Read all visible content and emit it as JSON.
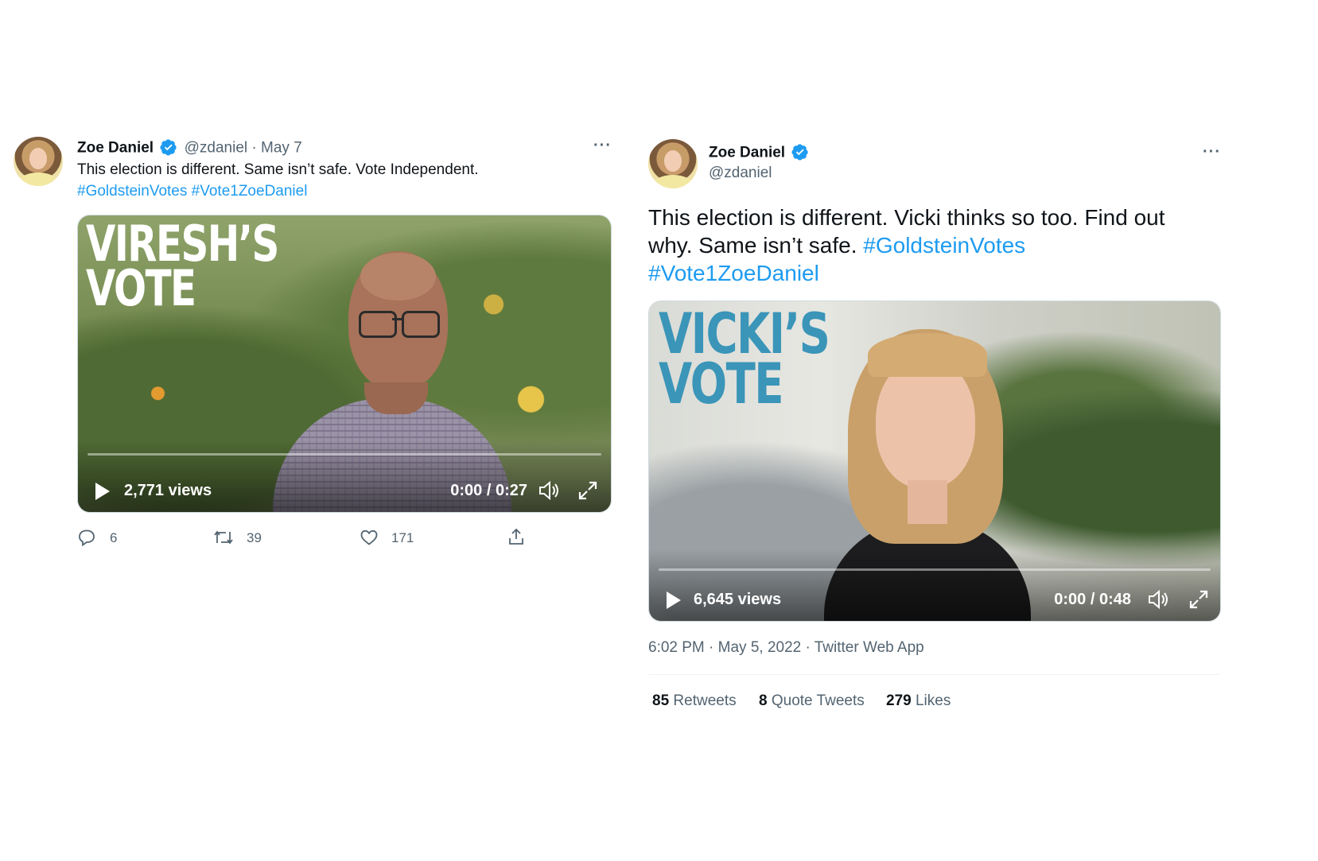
{
  "left_tweet": {
    "name": "Zoe Daniel",
    "handle": "@zdaniel",
    "separator": "·",
    "date": "May 7",
    "text": "This election is different. Same isn’t safe. Vote Independent.",
    "hashtag1": "#GoldsteinVotes",
    "hashtag2": "#Vote1ZoeDaniel",
    "video": {
      "overlay_line1": "VIRESH’S",
      "overlay_line2": "VOTE",
      "views": "2,771 views",
      "time": "0:00 / 0:27"
    },
    "actions": {
      "replies": "6",
      "retweets": "39",
      "likes": "171"
    },
    "colors": {
      "overlay": "#ffffff"
    }
  },
  "right_tweet": {
    "name": "Zoe Daniel",
    "handle": "@zdaniel",
    "text_part1": "This election is different. Vicki thinks so too. Find out",
    "text_part2": "why. Same isn’t safe.",
    "hashtag1": "#GoldsteinVotes",
    "hashtag2": "#Vote1ZoeDaniel",
    "video": {
      "overlay_line1": "VICKI’S",
      "overlay_line2": "VOTE",
      "views": "6,645 views",
      "time": "0:00 / 0:48"
    },
    "meta": "6:02 PM · May 5, 2022 · Twitter Web App",
    "stats": {
      "retweets_count": "85",
      "retweets_label": "Retweets",
      "quotes_count": "8",
      "quotes_label": "Quote Tweets",
      "likes_count": "279",
      "likes_label": "Likes"
    },
    "colors": {
      "overlay": "#3a95b8"
    }
  },
  "icons": [
    "verified-badge-icon",
    "more-icon",
    "play-icon",
    "volume-icon",
    "fullscreen-icon",
    "reply-icon",
    "retweet-icon",
    "like-icon",
    "share-icon"
  ],
  "colors": {
    "link": "#1d9bf0",
    "muted": "#536471",
    "verified": "#1d9bf0"
  }
}
